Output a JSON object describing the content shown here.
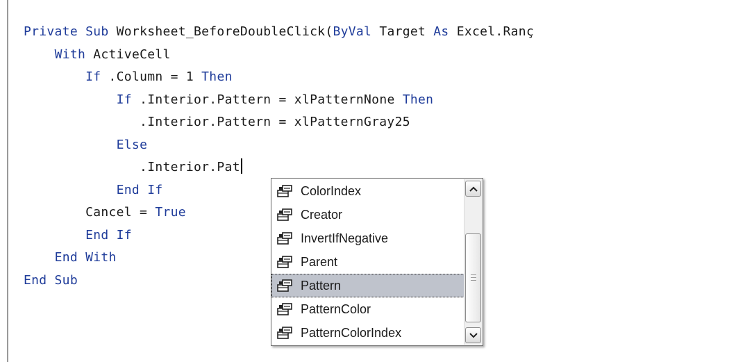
{
  "code": {
    "lines": [
      [
        {
          "t": "Private Sub ",
          "k": true
        },
        {
          "t": "Worksheet_BeforeDoubleClick(",
          "k": false
        },
        {
          "t": "ByVal",
          "k": true
        },
        {
          "t": " Target ",
          "k": false
        },
        {
          "t": "As",
          "k": true
        },
        {
          "t": " Excel.Ranç",
          "k": false
        }
      ],
      [
        {
          "t": "    ",
          "k": false
        },
        {
          "t": "With",
          "k": true
        },
        {
          "t": " ActiveCell",
          "k": false
        }
      ],
      [
        {
          "t": "        ",
          "k": false
        },
        {
          "t": "If",
          "k": true
        },
        {
          "t": " .Column = 1 ",
          "k": false
        },
        {
          "t": "Then",
          "k": true
        }
      ],
      [
        {
          "t": "            ",
          "k": false
        },
        {
          "t": "If",
          "k": true
        },
        {
          "t": " .Interior.Pattern = xlPatternNone ",
          "k": false
        },
        {
          "t": "Then",
          "k": true
        }
      ],
      [
        {
          "t": "               .Interior.Pattern = xlPatternGray25",
          "k": false
        }
      ],
      [
        {
          "t": "            ",
          "k": false
        },
        {
          "t": "Else",
          "k": true
        }
      ],
      [
        {
          "t": "               .Interior.Pat",
          "k": false
        }
      ],
      [
        {
          "t": "            ",
          "k": false
        },
        {
          "t": "End If",
          "k": true
        }
      ],
      [
        {
          "t": "        Cancel = ",
          "k": false
        },
        {
          "t": "True",
          "k": true
        }
      ],
      [
        {
          "t": "        ",
          "k": false
        },
        {
          "t": "End If",
          "k": true
        }
      ],
      [
        {
          "t": "    ",
          "k": false
        },
        {
          "t": "End With",
          "k": true
        }
      ],
      [
        {
          "t": "End Sub",
          "k": true
        }
      ]
    ],
    "caret_line": 6
  },
  "autocomplete": {
    "items": [
      {
        "label": "ColorIndex",
        "icon": "property-icon"
      },
      {
        "label": "Creator",
        "icon": "property-icon"
      },
      {
        "label": "InvertIfNegative",
        "icon": "property-icon"
      },
      {
        "label": "Parent",
        "icon": "property-icon"
      },
      {
        "label": "Pattern",
        "icon": "property-icon"
      },
      {
        "label": "PatternColor",
        "icon": "property-icon"
      },
      {
        "label": "PatternColorIndex",
        "icon": "property-icon"
      }
    ],
    "selected_index": 4
  },
  "colors": {
    "keyword": "#1f3c9a",
    "text": "#1a1a1a",
    "selection": "#bfc3cc"
  }
}
